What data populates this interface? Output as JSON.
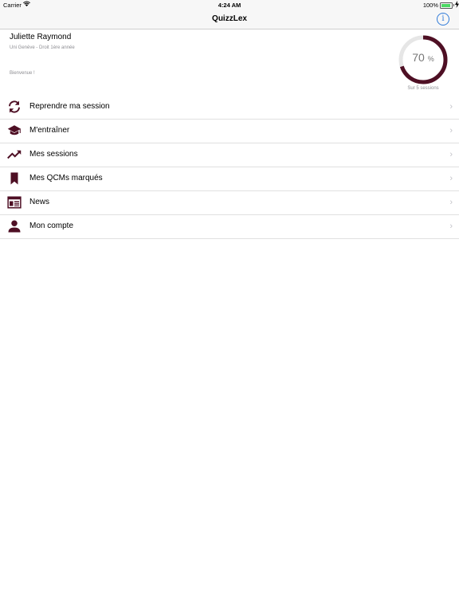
{
  "status_bar": {
    "carrier": "Carrier",
    "time": "4:24 AM",
    "battery": "100%"
  },
  "nav": {
    "title": "QuizzLex",
    "info_icon": "info-icon"
  },
  "profile": {
    "name": "Juliette Raymond",
    "subtitle": "Uni Genève - Droit 1ère année",
    "welcome": "Bienvenue !",
    "progress_value": "70",
    "progress_fraction": 0.7,
    "progress_unit": "%",
    "progress_caption": "Sur 5 sessions"
  },
  "colors": {
    "accent": "#4e0f24",
    "track": "#e6e6e6",
    "link": "#2f7ad8"
  },
  "menu": [
    {
      "label": "Reprendre ma session",
      "icon": "refresh-icon"
    },
    {
      "label": "M'entraîner",
      "icon": "graduation-cap-icon"
    },
    {
      "label": "Mes sessions",
      "icon": "trending-up-icon"
    },
    {
      "label": "Mes QCMs marqués",
      "icon": "bookmark-icon"
    },
    {
      "label": "News",
      "icon": "newspaper-icon"
    },
    {
      "label": "Mon compte",
      "icon": "person-icon"
    }
  ]
}
